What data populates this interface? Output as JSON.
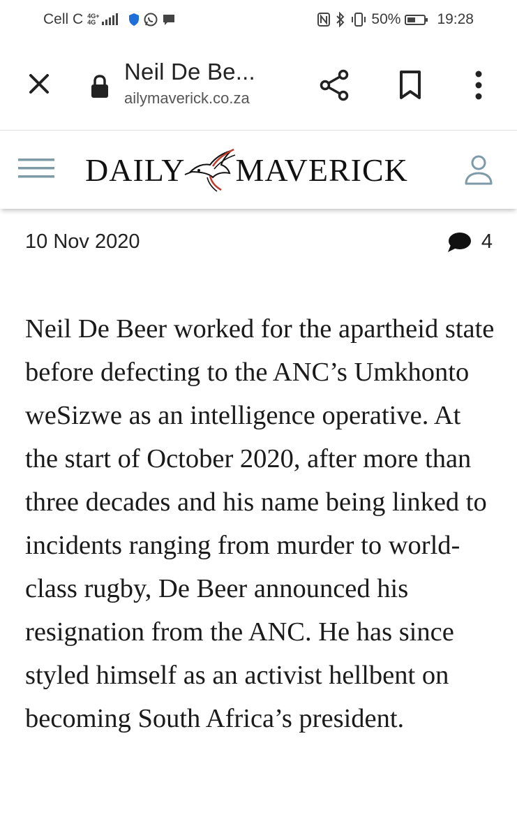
{
  "status_bar": {
    "carrier": "Cell C",
    "network_label_top": "4G+",
    "network_label_bottom": "4G",
    "icons_left": [
      "signal-icon",
      "shield-icon",
      "whatsapp-icon",
      "message-icon"
    ],
    "icons_right": [
      "nfc-icon",
      "bluetooth-icon",
      "vibrate-icon",
      "battery-icon"
    ],
    "battery_percent": "50%",
    "battery_level": 0.5,
    "time": "19:28"
  },
  "browser": {
    "tab_title": "Neil De Be...",
    "url": "ailymaverick.co.za"
  },
  "site": {
    "logo_left": "DAILY",
    "logo_right": "MAVERICK",
    "accent_color": "#c0392b"
  },
  "article": {
    "date": "10 Nov 2020",
    "comment_count": "4",
    "body": "Neil De Beer worked for the apartheid state before defecting to the ANC’s Umkhonto weSizwe as an intelligence operative. At the start of October 2020, after more than three decades and his name being linked to incidents ranging from murder to world-class rugby, De Beer announced his resignation from the ANC. He has since styled himself as an activist hellbent on becoming South Africa’s president."
  }
}
